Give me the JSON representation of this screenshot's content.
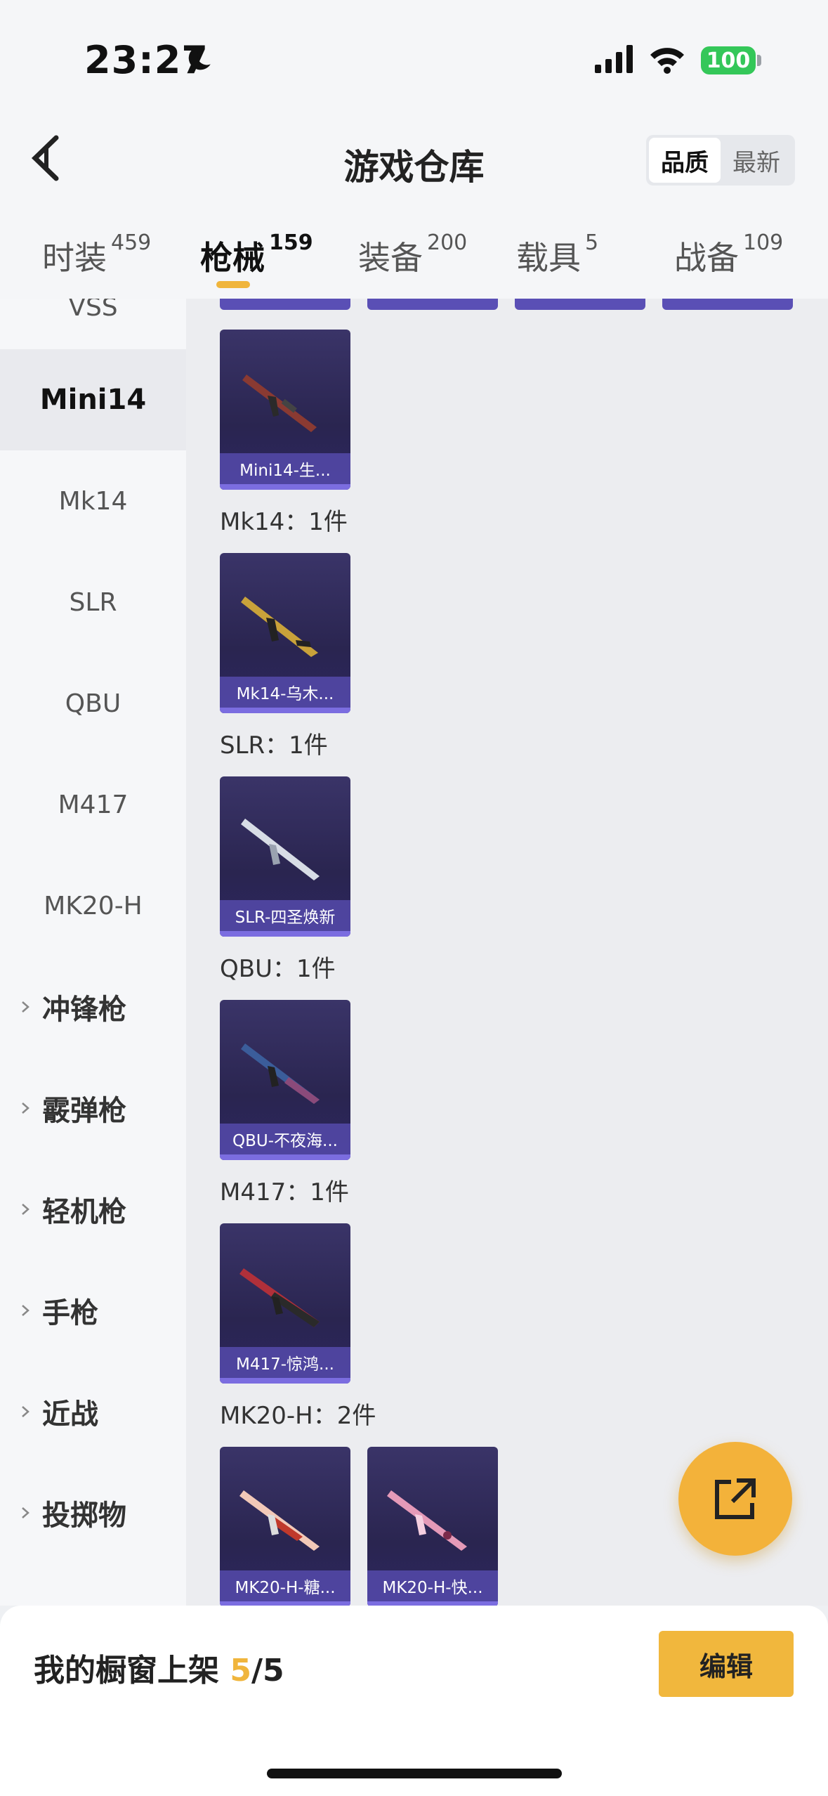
{
  "status": {
    "time": "23:27",
    "battery": "100"
  },
  "nav": {
    "title": "游戏仓库",
    "sort_quality": "品质",
    "sort_newest": "最新"
  },
  "tabs": [
    {
      "label": "时装",
      "count": "459"
    },
    {
      "label": "枪械",
      "count": "159"
    },
    {
      "label": "装备",
      "count": "200"
    },
    {
      "label": "载具",
      "count": "5"
    },
    {
      "label": "战备",
      "count": "109"
    }
  ],
  "sidebar": {
    "partial_item": "VSS",
    "items": [
      "Mini14",
      "Mk14",
      "SLR",
      "QBU",
      "M417",
      "MK20-H"
    ],
    "groups": [
      "冲锋枪",
      "霰弹枪",
      "轻机枪",
      "手枪",
      "近战",
      "投掷物"
    ]
  },
  "sections": [
    {
      "label": "",
      "items": [
        "Mini14-生..."
      ]
    },
    {
      "label": "Mk14：1件",
      "items": [
        "Mk14-乌木..."
      ]
    },
    {
      "label": "SLR：1件",
      "items": [
        "SLR-四圣焕新"
      ]
    },
    {
      "label": "QBU：1件",
      "items": [
        "QBU-不夜海..."
      ]
    },
    {
      "label": "M417：1件",
      "items": [
        "M417-惊鸿..."
      ]
    },
    {
      "label": "MK20-H：2件",
      "items": [
        "MK20-H-糖...",
        "MK20-H-快..."
      ]
    }
  ],
  "bottom": {
    "label": "我的橱窗上架 ",
    "current": "5",
    "total": "/5",
    "edit": "编辑"
  },
  "colors": {
    "accent": "#f0b53c",
    "card": "#2a2550",
    "battery": "#34c759"
  }
}
